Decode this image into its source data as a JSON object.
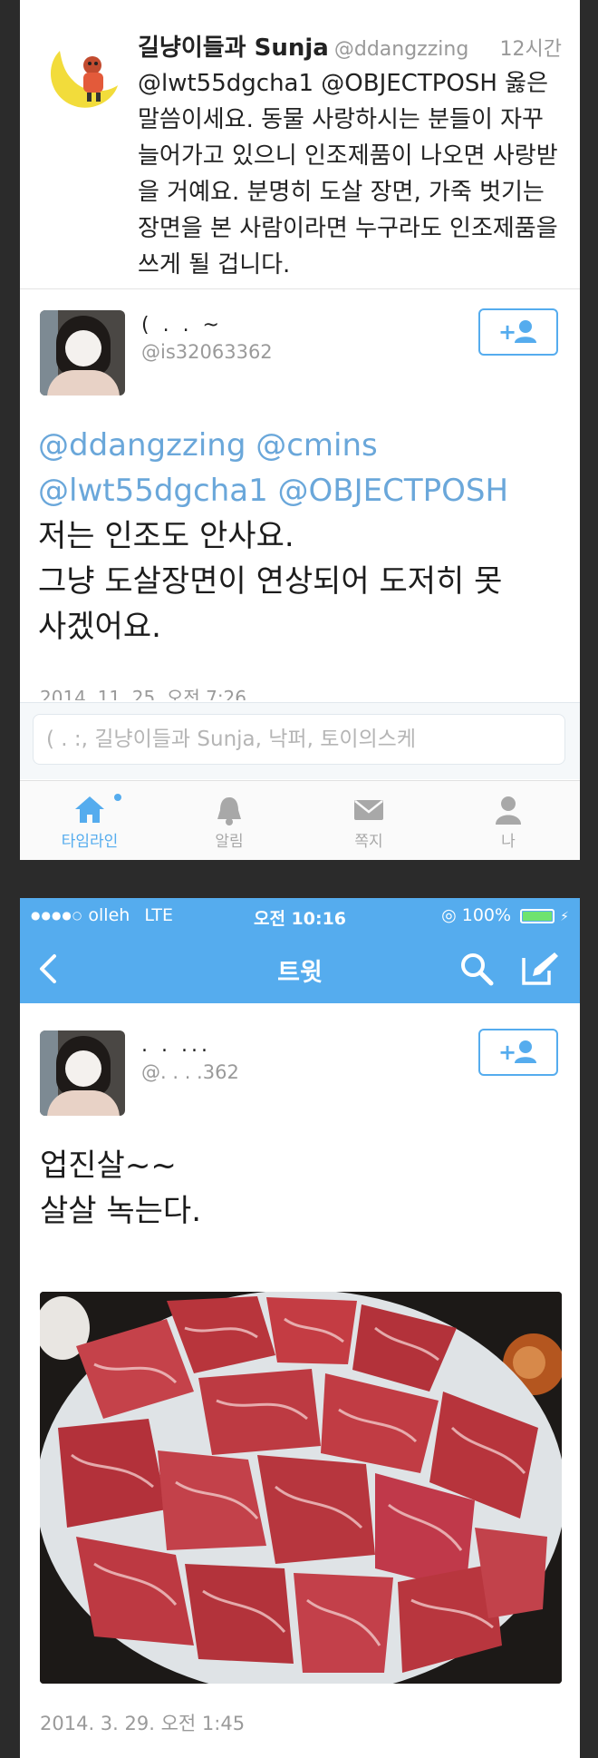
{
  "first_tweet": {
    "name": "길냥이들과 Sunja",
    "handle": "@ddangzzing",
    "time": "12시간",
    "text": "@lwt55dgcha1 @OBJECTPOSH 옳은 말씀이세요. 동물 사랑하시는 분들이 자꾸 늘어가고 있으니 인조제품이 나오면 사랑받을 거예요. 분명히 도살 장면, 가죽 벗기는 장면을 본 사람이라면 누구라도 인조제품을 쓰게 될 겁니다."
  },
  "user": {
    "name_blurred": "( . .  ~",
    "handle": "@is32063362",
    "handle_blurred": "@.  .  .  .362",
    "name2_blurred": "  .  .   ..."
  },
  "main_tweet": {
    "mentions_line1": "@ddangzzing @cmins",
    "mentions_line2": "@lwt55dgcha1 @OBJECTPOSH",
    "body_line1": "저는 인조도 안사요.",
    "body_line2": "그냥 도살장면이 연상되어 도저히 못",
    "body_line3": "사겠어요.",
    "date_partial": "2014. 11. 25. 오전 7:26"
  },
  "reply": {
    "placeholder": "(  .   :, 길냥이들과 Sunja, 낙퍼, 토이의스케"
  },
  "tabs": [
    {
      "label": "타임라인",
      "icon": "home-icon",
      "active": true
    },
    {
      "label": "알림",
      "icon": "bell-icon",
      "active": false
    },
    {
      "label": "쪽지",
      "icon": "envelope-icon",
      "active": false
    },
    {
      "label": "나",
      "icon": "person-icon",
      "active": false
    }
  ],
  "status_bar": {
    "carrier": "olleh",
    "network": "LTE",
    "time": "오전 10:16",
    "battery": "100%",
    "battery_level": 1.0
  },
  "navbar": {
    "title": "트윗"
  },
  "second_tweet": {
    "text": "업진살~~\n살살 녹는다.",
    "date": "2014. 3. 29. 오전 1:45"
  },
  "colors": {
    "twitter_blue": "#55acee",
    "mention_blue": "#6aa7da",
    "background_dark": "#2b2b2b"
  }
}
